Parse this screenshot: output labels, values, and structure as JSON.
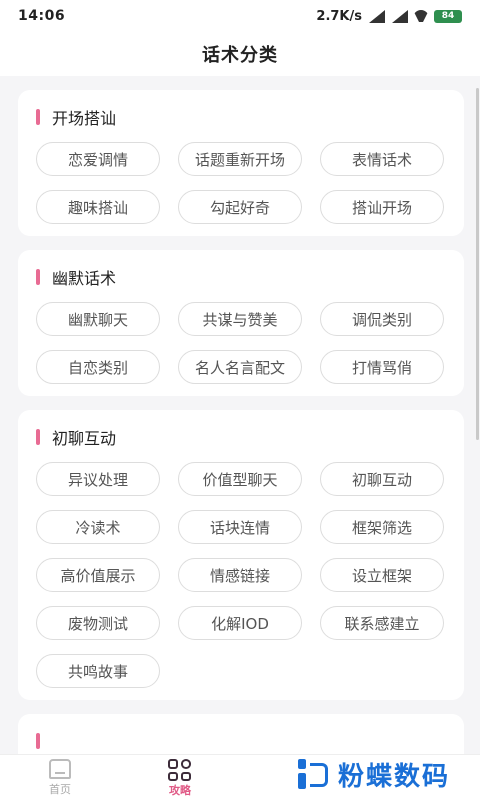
{
  "status": {
    "time": "14:06",
    "speed": "2.7K/s",
    "battery": "84"
  },
  "header": {
    "title": "话术分类"
  },
  "sections": [
    {
      "title": "开场搭讪",
      "tags": [
        "恋爱调情",
        "话题重新开场",
        "表情话术",
        "趣味搭讪",
        "勾起好奇",
        "搭讪开场"
      ]
    },
    {
      "title": "幽默话术",
      "tags": [
        "幽默聊天",
        "共谋与赞美",
        "调侃类别",
        "自恋类别",
        "名人名言配文",
        "打情骂俏"
      ]
    },
    {
      "title": "初聊互动",
      "tags": [
        "异议处理",
        "价值型聊天",
        "初聊互动",
        "冷读术",
        "话块连情",
        "框架筛选",
        "高价值展示",
        "情感链接",
        "设立框架",
        "废物测试",
        "化解IOD",
        "联系感建立",
        "共鸣故事"
      ]
    }
  ],
  "tabbar": {
    "home": "首页",
    "guide": "攻略"
  },
  "watermark": {
    "text": "粉蝶数码"
  },
  "colors": {
    "accent": "#e86b93",
    "brand": "#1a6fd6"
  }
}
